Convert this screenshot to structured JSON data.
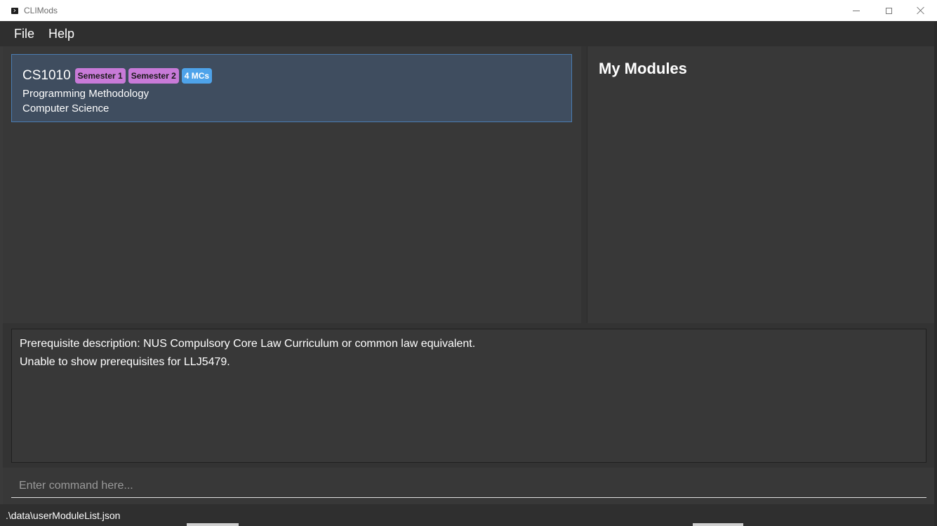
{
  "window": {
    "title": "CLIMods"
  },
  "menu": {
    "items": [
      "File",
      "Help"
    ]
  },
  "module_list": [
    {
      "code": "CS1010",
      "badges": [
        "Semester 1",
        "Semester 2"
      ],
      "credits": "4 MCs",
      "title": "Programming Methodology",
      "department": "Computer Science"
    }
  ],
  "my_modules": {
    "heading": "My Modules"
  },
  "result": {
    "lines": [
      "Prerequisite description: NUS Compulsory Core Law Curriculum or common law equivalent.",
      "Unable to show prerequisites for LLJ5479."
    ]
  },
  "command": {
    "placeholder": "Enter command here...",
    "value": ""
  },
  "status": {
    "file_path": ".\\data\\userModuleList.json"
  },
  "colors": {
    "card_bg": "#3f4d5f",
    "card_border": "#4a7db3",
    "semester_badge": "#c87ad8",
    "mc_badge": "#4ea3ea"
  }
}
